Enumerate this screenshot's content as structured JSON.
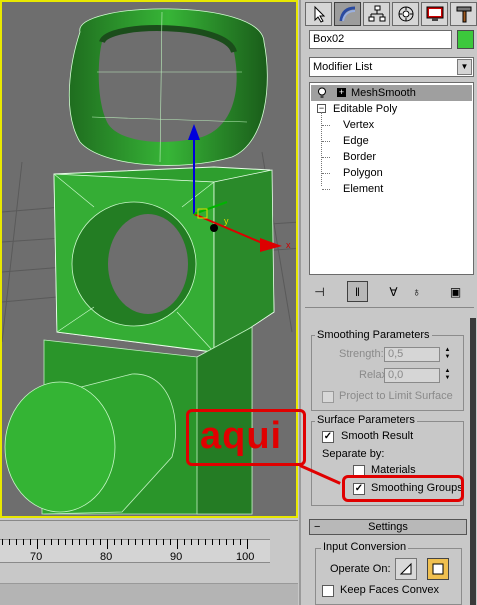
{
  "viewport": {
    "axis_x_label": "x",
    "axis_y_label": "y"
  },
  "timeline": {
    "labels": [
      "70",
      "80",
      "90",
      "100"
    ]
  },
  "command_panel": {
    "tabs": [
      {
        "icon": "arrow-cursor-icon"
      },
      {
        "icon": "modify-curve-icon"
      },
      {
        "icon": "hierarchy-icon"
      },
      {
        "icon": "motion-icon"
      },
      {
        "icon": "display-icon"
      },
      {
        "icon": "utilities-hammer-icon"
      }
    ],
    "object_name": "Box02",
    "object_color": "#3cc83c",
    "modifier_list_label": "Modifier List",
    "stack": {
      "top_modifier": "MeshSmooth",
      "base_object": "Editable Poly",
      "sub_objects": [
        "Vertex",
        "Edge",
        "Border",
        "Polygon",
        "Element"
      ]
    }
  },
  "smoothing_params": {
    "title": "Smoothing Parameters",
    "strength_label": "Strength:",
    "strength_value": "0,5",
    "relax_label": "Relax:",
    "relax_value": "0,0",
    "limit_surface_label": "Project to Limit Surface",
    "limit_surface_checked": false
  },
  "surface_params": {
    "title": "Surface Parameters",
    "smooth_result_label": "Smooth Result",
    "smooth_result_checked": true,
    "separate_by_label": "Separate by:",
    "materials_label": "Materials",
    "materials_checked": false,
    "smoothing_groups_label": "Smoothing Groups",
    "smoothing_groups_checked": true
  },
  "settings": {
    "rollout_label": "Settings",
    "input_conversion_title": "Input Conversion",
    "operate_on_label": "Operate On:",
    "keep_faces_convex_label": "Keep Faces Convex",
    "keep_faces_convex_checked": false
  },
  "annotation": {
    "text": "aqui",
    "color": "#e00000"
  }
}
